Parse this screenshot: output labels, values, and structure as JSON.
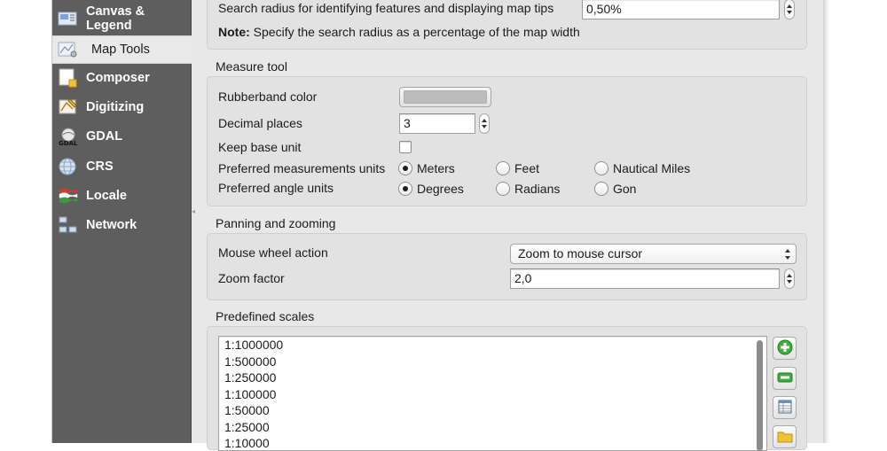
{
  "sidebar": {
    "items": [
      {
        "label": "Canvas & Legend",
        "icon": "canvas-legend-icon"
      },
      {
        "label": "Map Tools",
        "icon": "map-tools-icon",
        "selected": true
      },
      {
        "label": "Composer",
        "icon": "composer-icon"
      },
      {
        "label": "Digitizing",
        "icon": "digitizing-icon"
      },
      {
        "label": "GDAL",
        "icon": "gdal-icon"
      },
      {
        "label": "CRS",
        "icon": "crs-globe-icon"
      },
      {
        "label": "Locale",
        "icon": "locale-flag-icon"
      },
      {
        "label": "Network",
        "icon": "network-icon"
      }
    ]
  },
  "identify": {
    "search_radius_label": "Search radius for identifying features and displaying map tips",
    "search_radius_value": "0,50%",
    "note_bold": "Note:",
    "note_text": "Specify the search radius as a percentage of the map width"
  },
  "measure_tool": {
    "title": "Measure tool",
    "rubberband_label": "Rubberband color",
    "rubberband_color": "#bcbcbc",
    "decimal_places_label": "Decimal places",
    "decimal_places_value": "3",
    "keep_base_unit_label": "Keep base unit",
    "keep_base_unit_checked": false,
    "measurement_units_label": "Preferred measurements units",
    "measurement_units": [
      {
        "label": "Meters",
        "checked": true
      },
      {
        "label": "Feet",
        "checked": false
      },
      {
        "label": "Nautical Miles",
        "checked": false
      }
    ],
    "angle_units_label": "Preferred angle units",
    "angle_units": [
      {
        "label": "Degrees",
        "checked": true
      },
      {
        "label": "Radians",
        "checked": false
      },
      {
        "label": "Gon",
        "checked": false
      }
    ]
  },
  "panning": {
    "title": "Panning and zooming",
    "mouse_wheel_label": "Mouse wheel action",
    "mouse_wheel_value": "Zoom to mouse cursor",
    "zoom_factor_label": "Zoom factor",
    "zoom_factor_value": "2,0"
  },
  "predefined_scales": {
    "title": "Predefined scales",
    "scales": [
      "1:1000000",
      "1:500000",
      "1:250000",
      "1:100000",
      "1:50000",
      "1:25000",
      "1:10000"
    ],
    "buttons": [
      {
        "name": "add-scale-button",
        "icon": "plus-icon"
      },
      {
        "name": "remove-scale-button",
        "icon": "minus-icon"
      },
      {
        "name": "import-scales-button",
        "icon": "table-icon"
      },
      {
        "name": "export-scales-button",
        "icon": "folder-icon"
      }
    ]
  }
}
